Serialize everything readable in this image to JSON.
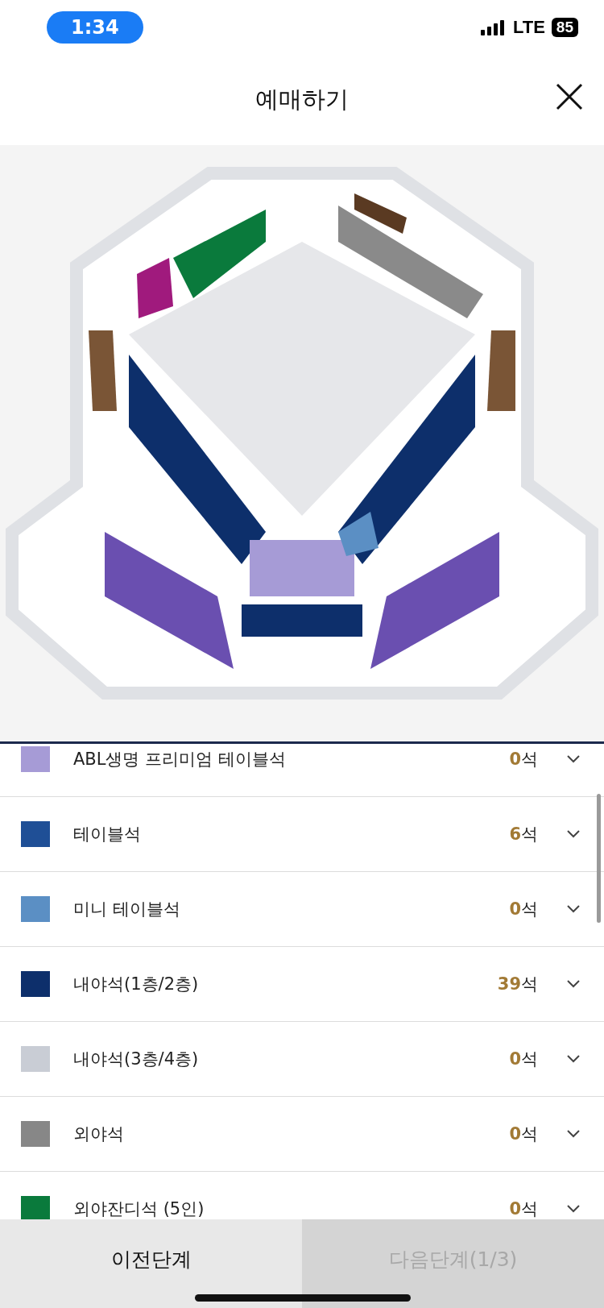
{
  "status_bar": {
    "time": "1:34",
    "network": "LTE",
    "battery": "85"
  },
  "header": {
    "title": "예매하기"
  },
  "seat_grades": [
    {
      "name": "ABL생명 프리미엄 테이블석",
      "color": "#a69bd6",
      "count": "0",
      "unit": "석"
    },
    {
      "name": "테이블석",
      "color": "#1f4f96",
      "count": "6",
      "unit": "석"
    },
    {
      "name": "미니 테이블석",
      "color": "#5b8fc4",
      "count": "0",
      "unit": "석"
    },
    {
      "name": "내야석(1층/2층)",
      "color": "#0d2f6b",
      "count": "39",
      "unit": "석"
    },
    {
      "name": "내야석(3층/4층)",
      "color": "#c9cdd5",
      "count": "0",
      "unit": "석"
    },
    {
      "name": "외야석",
      "color": "#878787",
      "count": "0",
      "unit": "석"
    },
    {
      "name": "외야잔디석 (5인)",
      "color": "#0a7a3c",
      "count": "0",
      "unit": "석"
    }
  ],
  "footer": {
    "prev": {
      "label": "이전단계",
      "disabled": false
    },
    "next": {
      "label": "다음단계(1/3)",
      "disabled": true
    }
  }
}
